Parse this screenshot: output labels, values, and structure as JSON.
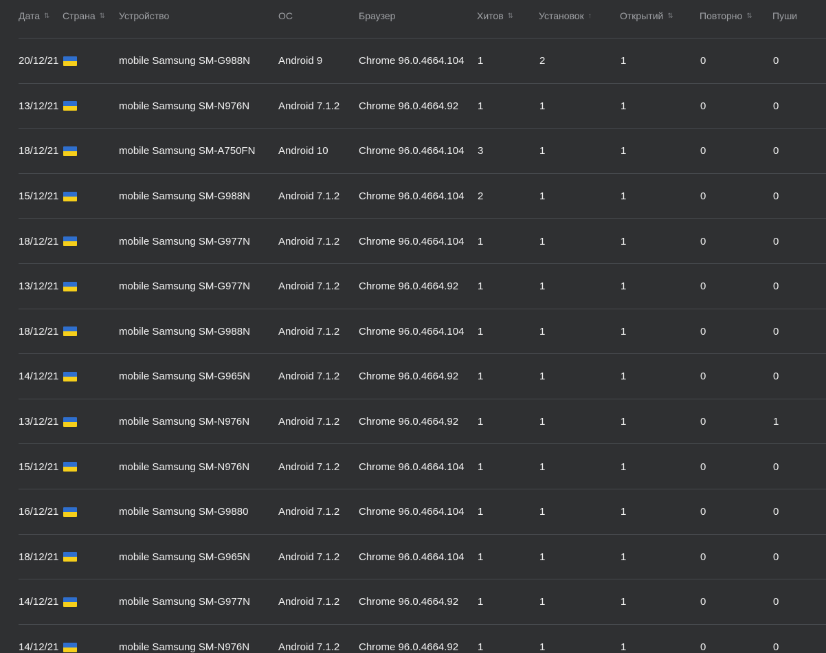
{
  "table": {
    "headers": [
      {
        "label": "Дата",
        "sort": "⇅"
      },
      {
        "label": "Страна",
        "sort": "⇅"
      },
      {
        "label": "Устройство",
        "sort": ""
      },
      {
        "label": "ОС",
        "sort": ""
      },
      {
        "label": "Браузер",
        "sort": ""
      },
      {
        "label": "Хитов",
        "sort": "⇅"
      },
      {
        "label": "Установок",
        "sort": "↑"
      },
      {
        "label": "Открытий",
        "sort": "⇅"
      },
      {
        "label": "Повторно",
        "sort": "⇅"
      },
      {
        "label": "Пуши",
        "sort": ""
      }
    ],
    "flag": {
      "icon": "ukraine-flag-icon",
      "colors": [
        "#2f6fce",
        "#f6cf1b"
      ]
    },
    "rows": [
      {
        "date": "20/12/21",
        "device": "mobile Samsung SM-G988N",
        "os": "Android 9",
        "browser": "Chrome 96.0.4664.104",
        "hits": "1",
        "installs": "2",
        "opens": "1",
        "repeat": "0",
        "pushes": "0"
      },
      {
        "date": "13/12/21",
        "device": "mobile Samsung SM-N976N",
        "os": "Android 7.1.2",
        "browser": "Chrome 96.0.4664.92",
        "hits": "1",
        "installs": "1",
        "opens": "1",
        "repeat": "0",
        "pushes": "0"
      },
      {
        "date": "18/12/21",
        "device": "mobile Samsung SM-A750FN",
        "os": "Android 10",
        "browser": "Chrome 96.0.4664.104",
        "hits": "3",
        "installs": "1",
        "opens": "1",
        "repeat": "0",
        "pushes": "0"
      },
      {
        "date": "15/12/21",
        "device": "mobile Samsung SM-G988N",
        "os": "Android 7.1.2",
        "browser": "Chrome 96.0.4664.104",
        "hits": "2",
        "installs": "1",
        "opens": "1",
        "repeat": "0",
        "pushes": "0"
      },
      {
        "date": "18/12/21",
        "device": "mobile Samsung SM-G977N",
        "os": "Android 7.1.2",
        "browser": "Chrome 96.0.4664.104",
        "hits": "1",
        "installs": "1",
        "opens": "1",
        "repeat": "0",
        "pushes": "0"
      },
      {
        "date": "13/12/21",
        "device": "mobile Samsung SM-G977N",
        "os": "Android 7.1.2",
        "browser": "Chrome 96.0.4664.92",
        "hits": "1",
        "installs": "1",
        "opens": "1",
        "repeat": "0",
        "pushes": "0"
      },
      {
        "date": "18/12/21",
        "device": "mobile Samsung SM-G988N",
        "os": "Android 7.1.2",
        "browser": "Chrome 96.0.4664.104",
        "hits": "1",
        "installs": "1",
        "opens": "1",
        "repeat": "0",
        "pushes": "0"
      },
      {
        "date": "14/12/21",
        "device": "mobile Samsung SM-G965N",
        "os": "Android 7.1.2",
        "browser": "Chrome 96.0.4664.92",
        "hits": "1",
        "installs": "1",
        "opens": "1",
        "repeat": "0",
        "pushes": "0"
      },
      {
        "date": "13/12/21",
        "device": "mobile Samsung SM-N976N",
        "os": "Android 7.1.2",
        "browser": "Chrome 96.0.4664.92",
        "hits": "1",
        "installs": "1",
        "opens": "1",
        "repeat": "0",
        "pushes": "1"
      },
      {
        "date": "15/12/21",
        "device": "mobile Samsung SM-N976N",
        "os": "Android 7.1.2",
        "browser": "Chrome 96.0.4664.104",
        "hits": "1",
        "installs": "1",
        "opens": "1",
        "repeat": "0",
        "pushes": "0"
      },
      {
        "date": "16/12/21",
        "device": "mobile Samsung SM-G9880",
        "os": "Android 7.1.2",
        "browser": "Chrome 96.0.4664.104",
        "hits": "1",
        "installs": "1",
        "opens": "1",
        "repeat": "0",
        "pushes": "0"
      },
      {
        "date": "18/12/21",
        "device": "mobile Samsung SM-G965N",
        "os": "Android 7.1.2",
        "browser": "Chrome 96.0.4664.104",
        "hits": "1",
        "installs": "1",
        "opens": "1",
        "repeat": "0",
        "pushes": "0"
      },
      {
        "date": "14/12/21",
        "device": "mobile Samsung SM-G977N",
        "os": "Android 7.1.2",
        "browser": "Chrome 96.0.4664.92",
        "hits": "1",
        "installs": "1",
        "opens": "1",
        "repeat": "0",
        "pushes": "0"
      },
      {
        "date": "14/12/21",
        "device": "mobile Samsung SM-N976N",
        "os": "Android 7.1.2",
        "browser": "Chrome 96.0.4664.92",
        "hits": "1",
        "installs": "1",
        "opens": "1",
        "repeat": "0",
        "pushes": "0"
      }
    ]
  }
}
